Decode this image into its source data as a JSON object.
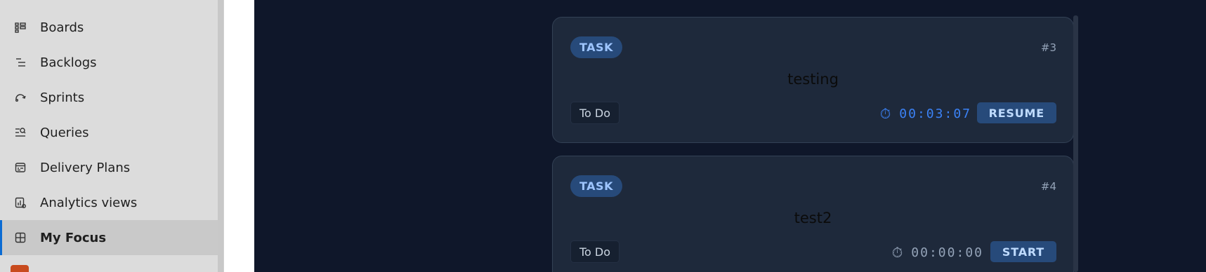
{
  "sidebar": {
    "items": [
      {
        "label": "Boards",
        "icon": "boards-icon",
        "active": false
      },
      {
        "label": "Backlogs",
        "icon": "backlogs-icon",
        "active": false
      },
      {
        "label": "Sprints",
        "icon": "sprints-icon",
        "active": false
      },
      {
        "label": "Queries",
        "icon": "queries-icon",
        "active": false
      },
      {
        "label": "Delivery Plans",
        "icon": "delivery-plans-icon",
        "active": false
      },
      {
        "label": "Analytics views",
        "icon": "analytics-views-icon",
        "active": false
      },
      {
        "label": "My Focus",
        "icon": "my-focus-icon",
        "active": true
      }
    ]
  },
  "cards": [
    {
      "type": "TASK",
      "id": "#3",
      "title": "testing",
      "status": "To Do",
      "timer": "00:03:07",
      "timer_icon": "stopwatch-icon",
      "timer_active": true,
      "action": "RESUME"
    },
    {
      "type": "TASK",
      "id": "#4",
      "title": "test2",
      "status": "To Do",
      "timer": "00:00:00",
      "timer_icon": "stopwatch-icon",
      "timer_active": false,
      "action": "START"
    }
  ],
  "colors": {
    "background": "#0f172a",
    "card": "#1e293b",
    "accent": "#0b6bd3",
    "timer_active": "#3b82f6",
    "timer_idle": "#94a3b8"
  }
}
